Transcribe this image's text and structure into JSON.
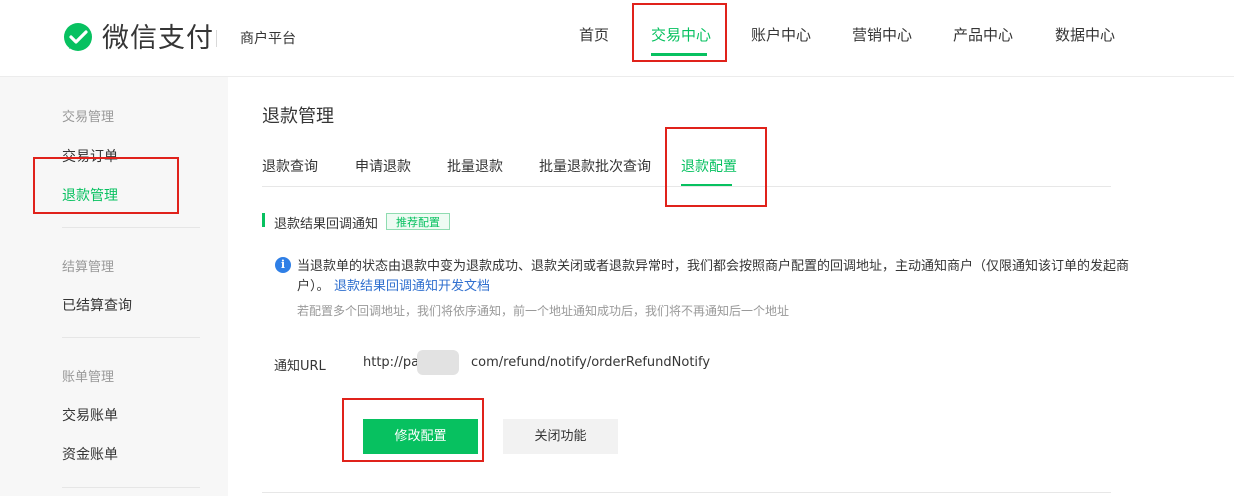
{
  "header": {
    "logo_text": "微信支付",
    "platform": "商户平台",
    "nav": [
      "首页",
      "交易中心",
      "账户中心",
      "营销中心",
      "产品中心",
      "数据中心"
    ],
    "active_nav": "交易中心"
  },
  "sidebar": {
    "groups": [
      {
        "title": "交易管理",
        "items": [
          "交易订单",
          "退款管理"
        ]
      },
      {
        "title": "结算管理",
        "items": [
          "已结算查询"
        ]
      },
      {
        "title": "账单管理",
        "items": [
          "交易账单",
          "资金账单"
        ]
      }
    ],
    "active_item": "退款管理"
  },
  "main": {
    "title": "退款管理",
    "tabs": [
      "退款查询",
      "申请退款",
      "批量退款",
      "批量退款批次查询",
      "退款配置"
    ],
    "active_tab": "退款配置",
    "section": {
      "title": "退款结果回调通知",
      "badge": "推荐配置",
      "info_line1": "当退款单的状态由退款中变为退款成功、退款关闭或者退款异常时，我们都会按照商户配置的回调地址，主动通知商户（仅限通知该订单的发起商",
      "info_line2": "户）。",
      "info_link": "退款结果回调通知开发文档",
      "info_sub": "若配置多个回调地址，我们将依序通知，前一个地址通知成功后，我们将不再通知后一个地址"
    },
    "notify": {
      "label": "通知URL",
      "url_prefix": "http://pay.",
      "url_suffix": "com/refund/notify/orderRefundNotify"
    },
    "buttons": {
      "modify": "修改配置",
      "close": "关闭功能"
    }
  },
  "colors": {
    "accent": "#07c160",
    "highlight_box": "#e0221b",
    "link": "#2f6fcf",
    "info_icon": "#2f7fe6"
  },
  "icons": {
    "logo": "wechat-pay-logo-icon",
    "info": "info-icon"
  }
}
